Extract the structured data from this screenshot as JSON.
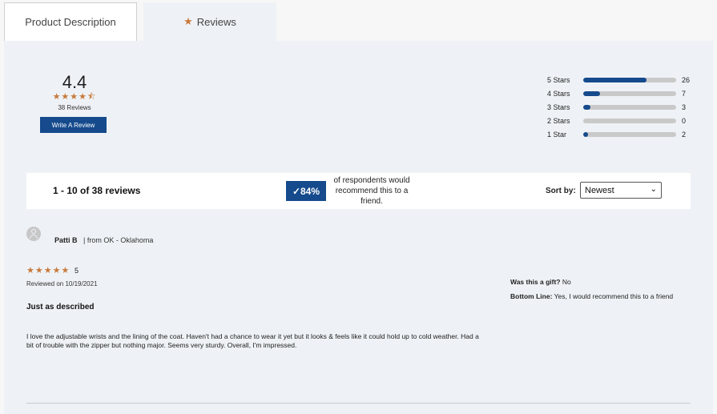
{
  "tabs": {
    "description_label": "Product Description",
    "reviews_label": "Reviews"
  },
  "summary": {
    "average": "4.4",
    "stars": "★★★★⯪",
    "count_label": "38 Reviews",
    "write_button": "Write A Review"
  },
  "histogram": [
    {
      "label": "5 Stars",
      "count": "26",
      "fraction": 0.684
    },
    {
      "label": "4 Stars",
      "count": "7",
      "fraction": 0.184
    },
    {
      "label": "3 Stars",
      "count": "3",
      "fraction": 0.079
    },
    {
      "label": "2 Stars",
      "count": "0",
      "fraction": 0.0
    },
    {
      "label": "1 Star",
      "count": "2",
      "fraction": 0.053
    }
  ],
  "toolbar": {
    "range": "1 - 10 of 38 reviews",
    "recommend_pct": "✓84%",
    "recommend_text": "of respondents would recommend this to a friend.",
    "sort_label": "Sort by:",
    "sort_value": "Newest"
  },
  "review": {
    "author": "Patti B",
    "location": "| from OK - Oklahoma",
    "stars": "★★★★★",
    "score": "5",
    "date": "Reviewed on 10/19/2021",
    "title": "Just as described",
    "body": "I love the adjustable wrists and the lining of the coat. Haven't had a chance to wear it yet but it looks & feels like it could hold up to cold weather. Had a bit of trouble with the zipper but nothing major. Seems very sturdy. Overall, I'm impressed.",
    "gift_label": "Was this a gift?",
    "gift_value": "No",
    "bottom_label": "Bottom Line:",
    "bottom_value": "Yes, I would recommend this to a friend"
  },
  "colors": {
    "accent": "#154a8c",
    "star": "#c8793c"
  }
}
